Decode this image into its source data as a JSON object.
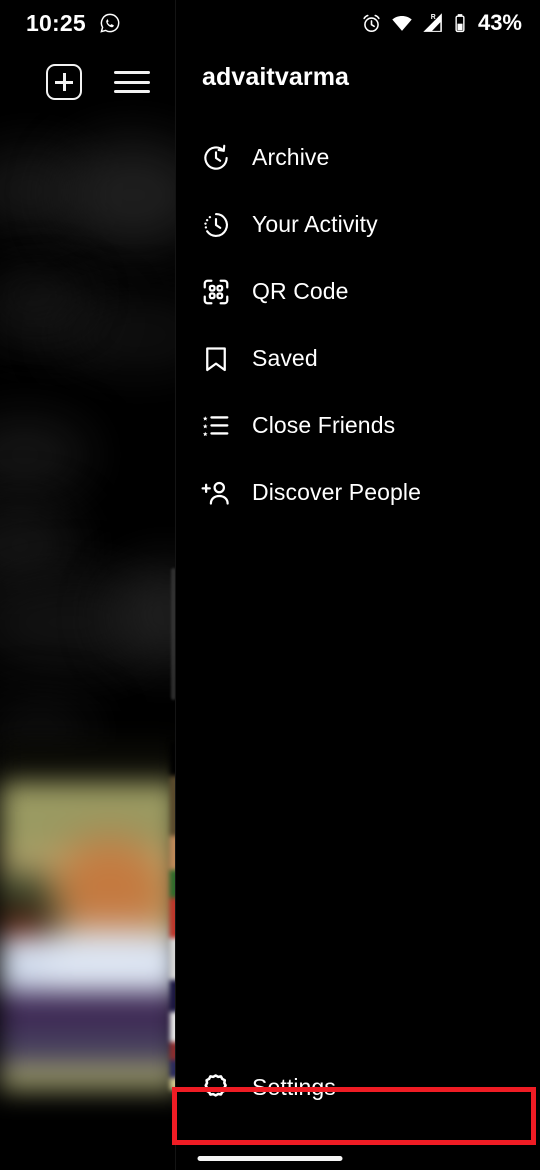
{
  "status_bar": {
    "time": "10:25",
    "notification_icon": "whatsapp-icon",
    "alarm_icon": "alarm-clock-icon",
    "wifi_icon": "wifi-icon",
    "signal_icon": "cellular-signal-roaming-icon",
    "battery_icon": "battery-icon",
    "battery_percent": "43%"
  },
  "topbar": {
    "add_label": "new-post",
    "menu_label": "menu"
  },
  "drawer": {
    "username": "advaitvarma",
    "items": [
      {
        "icon": "archive-clock-icon",
        "label": "Archive"
      },
      {
        "icon": "activity-clock-icon",
        "label": "Your Activity"
      },
      {
        "icon": "qr-code-icon",
        "label": "QR Code"
      },
      {
        "icon": "bookmark-icon",
        "label": "Saved"
      },
      {
        "icon": "star-list-icon",
        "label": "Close Friends"
      },
      {
        "icon": "person-add-icon",
        "label": "Discover People"
      }
    ],
    "settings": {
      "icon": "gear-icon",
      "label": "Settings"
    }
  },
  "annotation": {
    "highlight_color": "#ef1c24",
    "target": "Settings"
  },
  "theme": {
    "background": "#000000",
    "text": "#ffffff",
    "divider": "#141414"
  }
}
